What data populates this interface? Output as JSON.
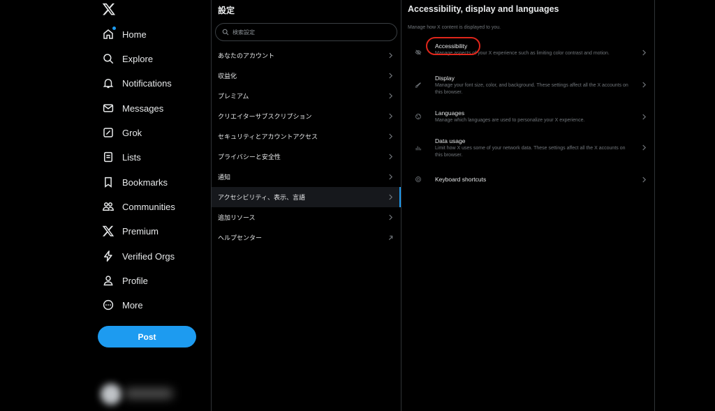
{
  "nav": {
    "items": [
      {
        "label": "Home",
        "icon": "home-icon"
      },
      {
        "label": "Explore",
        "icon": "search-icon"
      },
      {
        "label": "Notifications",
        "icon": "bell-icon"
      },
      {
        "label": "Messages",
        "icon": "envelope-icon"
      },
      {
        "label": "Grok",
        "icon": "grok-icon"
      },
      {
        "label": "Lists",
        "icon": "list-icon"
      },
      {
        "label": "Bookmarks",
        "icon": "bookmark-icon"
      },
      {
        "label": "Communities",
        "icon": "communities-icon"
      },
      {
        "label": "Premium",
        "icon": "x-logo-icon"
      },
      {
        "label": "Verified Orgs",
        "icon": "lightning-icon"
      },
      {
        "label": "Profile",
        "icon": "person-icon"
      },
      {
        "label": "More",
        "icon": "more-circle-icon"
      }
    ],
    "post_label": "Post"
  },
  "settings": {
    "title": "設定",
    "search_placeholder": "検索設定",
    "items": [
      {
        "label": "あなたのアカウント",
        "icon": "chevron-right-icon"
      },
      {
        "label": "収益化",
        "icon": "chevron-right-icon"
      },
      {
        "label": "プレミアム",
        "icon": "chevron-right-icon"
      },
      {
        "label": "クリエイターサブスクリプション",
        "icon": "chevron-right-icon"
      },
      {
        "label": "セキュリティとアカウントアクセス",
        "icon": "chevron-right-icon"
      },
      {
        "label": "プライバシーと安全性",
        "icon": "chevron-right-icon"
      },
      {
        "label": "通知",
        "icon": "chevron-right-icon"
      },
      {
        "label": "アクセシビリティ、表示、言語",
        "icon": "chevron-right-icon",
        "active": true
      },
      {
        "label": "追加リソース",
        "icon": "chevron-right-icon"
      },
      {
        "label": "ヘルプセンター",
        "icon": "external-arrow-icon"
      }
    ]
  },
  "detail": {
    "title": "Accessibility, display and languages",
    "subtitle": "Manage how X content is displayed to you.",
    "options": [
      {
        "title": "Accessibility",
        "description": "Manage aspects of your X experience such as limiting color contrast and motion.",
        "icon": "accessibility-icon",
        "highlighted": true
      },
      {
        "title": "Display",
        "description": "Manage your font size, color, and background. These settings affect all the X accounts on this browser.",
        "icon": "brush-icon"
      },
      {
        "title": "Languages",
        "description": "Manage which languages are used to personalize your X experience.",
        "icon": "globe-icon"
      },
      {
        "title": "Data usage",
        "description": "Limit how X uses some of your network data. These settings affect all the X accounts on this browser.",
        "icon": "bar-chart-icon"
      },
      {
        "title": "Keyboard shortcuts",
        "description": "",
        "icon": "keyboard-icon"
      }
    ]
  },
  "colors": {
    "accent": "#1d9bf0",
    "background": "#000000",
    "text_primary": "#e7e9ea",
    "text_secondary": "#71767b",
    "highlight_ring": "#e0261b"
  }
}
